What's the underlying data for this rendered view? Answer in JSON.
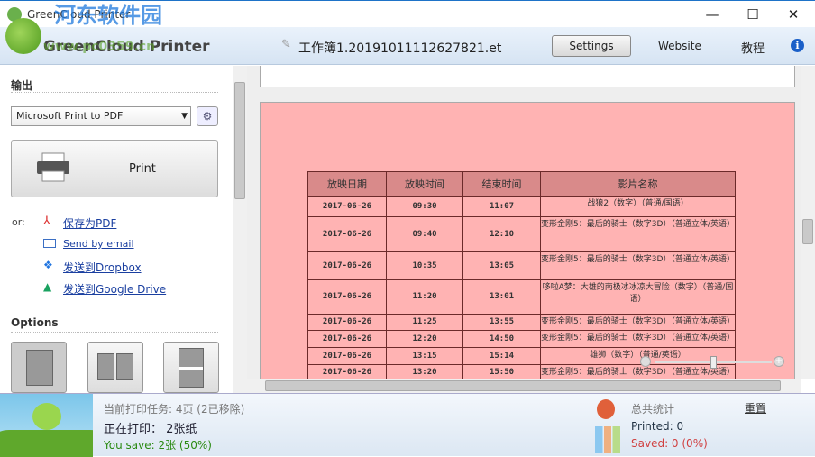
{
  "window": {
    "title": "GreenCloud Printer",
    "minimize": "—",
    "maximize": "☐",
    "close": "✕"
  },
  "watermark": {
    "site": "河东软件园",
    "url": "www.pc0359.cn"
  },
  "header": {
    "app_name": "GreenCloud Printer",
    "document": "工作簿1.20191011112627821.et",
    "settings": "Settings",
    "website": "Website",
    "tutorial": "教程",
    "info": "i"
  },
  "left": {
    "output_label": "输出",
    "printer": "Microsoft Print to PDF",
    "print": "Print",
    "or": "or:",
    "alternatives": [
      {
        "label": "保存为PDF",
        "icon": "pdf-icon"
      },
      {
        "label": "Send by email",
        "icon": "email-icon"
      },
      {
        "label": "发送到Dropbox",
        "icon": "dropbox-icon"
      },
      {
        "label": "发送到Google Drive",
        "icon": "google-drive-icon"
      }
    ],
    "options_label": "Options"
  },
  "table": {
    "headers": [
      "放映日期",
      "放映时间",
      "结束时间",
      "影片名称"
    ],
    "rows": [
      [
        "2017-06-26",
        "09:30",
        "11:07",
        "战狼2（数字）（普通/国语）"
      ],
      [
        "2017-06-26",
        "09:40",
        "12:10",
        "变形金刚5：最后的骑士（数字3D）（普通立体/英语）"
      ],
      [
        "2017-06-26",
        "10:35",
        "13:05",
        "变形金刚5：最后的骑士（数字3D）（普通立体/英语）"
      ],
      [
        "2017-06-26",
        "11:20",
        "13:01",
        "哆啦A梦：大雄的南极冰冰凉大冒险（数字）（普通/国语）"
      ],
      [
        "2017-06-26",
        "11:25",
        "13:55",
        "变形金刚5：最后的骑士（数字3D）（普通立体/英语）"
      ],
      [
        "2017-06-26",
        "12:20",
        "14:50",
        "变形金刚5：最后的骑士（数字3D）（普通立体/英语）"
      ],
      [
        "2017-06-26",
        "13:15",
        "15:14",
        "雄狮（数字）（普通/英语）"
      ],
      [
        "2017-06-26",
        "13:20",
        "15:50",
        "变形金刚5：最后的骑士（数字3D）（普通立体/英语）"
      ]
    ]
  },
  "status": {
    "job": "当前打印任务: 4页 (2已移除)",
    "printing": "正在打印： 2张纸",
    "save": "You save: 2张 (50%)",
    "total": "总共统计",
    "reset": "重置",
    "printed": "Printed: 0",
    "saved": "Saved: 0 (0%)"
  },
  "colors": {
    "save": "#2a8a12",
    "saved": "#d04040",
    "page": "#ffb3b3"
  }
}
